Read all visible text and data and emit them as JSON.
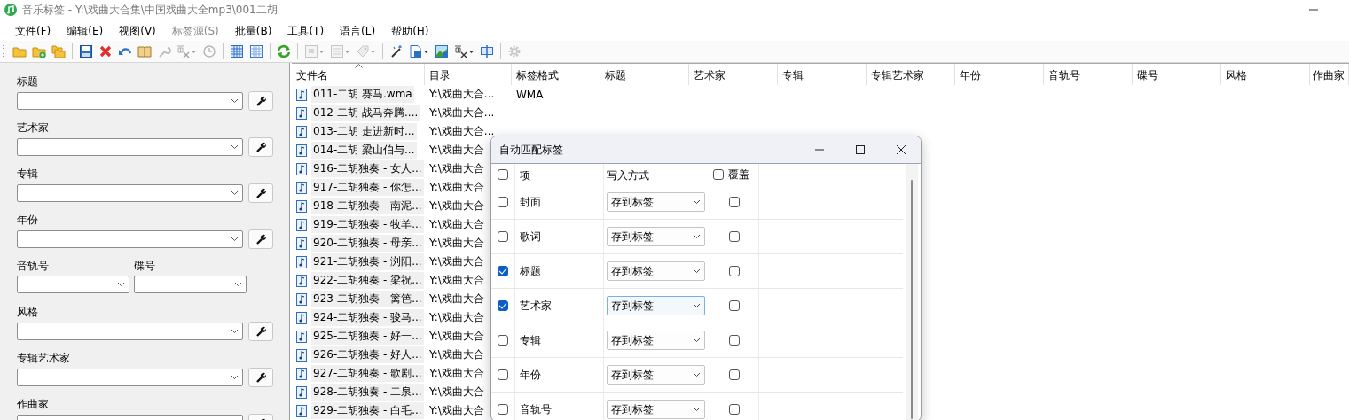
{
  "window": {
    "title": "音乐标签 - Y:\\戏曲大合集\\中国戏曲大全mp3\\001二胡"
  },
  "menu": [
    {
      "label": "文件(F)",
      "disabled": false
    },
    {
      "label": "编辑(E)",
      "disabled": false
    },
    {
      "label": "视图(V)",
      "disabled": false
    },
    {
      "label": "标签源(S)",
      "disabled": true
    },
    {
      "label": "批量(B)",
      "disabled": false
    },
    {
      "label": "工具(T)",
      "disabled": false
    },
    {
      "label": "语言(L)",
      "disabled": false
    },
    {
      "label": "帮助(H)",
      "disabled": false
    }
  ],
  "toolbar": [
    {
      "kind": "folder",
      "disabled": false,
      "dropdown": false
    },
    {
      "kind": "folder-add",
      "disabled": false,
      "dropdown": false
    },
    {
      "kind": "folders",
      "disabled": false,
      "dropdown": false
    },
    {
      "kind": "sep"
    },
    {
      "kind": "save",
      "disabled": false,
      "dropdown": false
    },
    {
      "kind": "delete",
      "disabled": false,
      "dropdown": false
    },
    {
      "kind": "undo",
      "disabled": false,
      "dropdown": false
    },
    {
      "kind": "book",
      "disabled": false,
      "dropdown": false
    },
    {
      "kind": "wrench",
      "disabled": true,
      "dropdown": false
    },
    {
      "kind": "convert",
      "disabled": true,
      "dropdown": true
    },
    {
      "kind": "clock",
      "disabled": true,
      "dropdown": false
    },
    {
      "kind": "sep"
    },
    {
      "kind": "grid",
      "disabled": false,
      "dropdown": false
    },
    {
      "kind": "grid-small",
      "disabled": false,
      "dropdown": false
    },
    {
      "kind": "sep"
    },
    {
      "kind": "refresh",
      "disabled": false,
      "dropdown": false
    },
    {
      "kind": "sep"
    },
    {
      "kind": "picture",
      "disabled": true,
      "dropdown": true
    },
    {
      "kind": "text",
      "disabled": true,
      "dropdown": true
    },
    {
      "kind": "tag",
      "disabled": true,
      "dropdown": true
    },
    {
      "kind": "sep"
    },
    {
      "kind": "wand",
      "disabled": false,
      "dropdown": false
    },
    {
      "kind": "doc-save",
      "disabled": false,
      "dropdown": true
    },
    {
      "kind": "picture-save",
      "disabled": false,
      "dropdown": false
    },
    {
      "kind": "convert",
      "disabled": false,
      "dropdown": true
    },
    {
      "kind": "window",
      "disabled": false,
      "dropdown": false
    },
    {
      "kind": "sep"
    },
    {
      "kind": "gear",
      "disabled": true,
      "dropdown": false
    }
  ],
  "tag_panel": {
    "fields": [
      {
        "kind": "single",
        "label": "标题"
      },
      {
        "kind": "single",
        "label": "艺术家"
      },
      {
        "kind": "single",
        "label": "专辑"
      },
      {
        "kind": "single",
        "label": "年份"
      },
      {
        "kind": "pair",
        "label": "音轨号",
        "label_2": "碟号"
      },
      {
        "kind": "single",
        "label": "风格"
      },
      {
        "kind": "single",
        "label": "专辑艺术家"
      },
      {
        "kind": "single",
        "label": "作曲家"
      }
    ]
  },
  "table": {
    "columns": [
      {
        "label": "文件名",
        "sorted_ascending": true
      },
      {
        "label": "目录",
        "sorted_ascending": false
      },
      {
        "label": "标签格式",
        "sorted_ascending": false
      },
      {
        "label": "标题",
        "sorted_ascending": false
      },
      {
        "label": "艺术家",
        "sorted_ascending": false
      },
      {
        "label": "专辑",
        "sorted_ascending": false
      },
      {
        "label": "专辑艺术家",
        "sorted_ascending": false
      },
      {
        "label": "年份",
        "sorted_ascending": false
      },
      {
        "label": "音轨号",
        "sorted_ascending": false
      },
      {
        "label": "碟号",
        "sorted_ascending": false
      },
      {
        "label": "风格",
        "sorted_ascending": false
      },
      {
        "label": "作曲家",
        "sorted_ascending": false
      }
    ],
    "rows": [
      {
        "file": "011-二胡 赛马.wma",
        "dir": "Y:\\戏曲大合...",
        "format": "WMA"
      },
      {
        "file": "012-二胡 战马奔腾....",
        "dir": "Y:\\戏曲大合..."
      },
      {
        "file": "013-二胡 走进新时...",
        "dir": "Y:\\戏曲大合..."
      },
      {
        "file": "014-二胡 梁山伯与...",
        "dir": "Y:\\戏曲大合"
      },
      {
        "file": "916-二胡独奏 - 女人...",
        "dir": "Y:\\戏曲大合"
      },
      {
        "file": "917-二胡独奏 - 你怎...",
        "dir": "Y:\\戏曲大合"
      },
      {
        "file": "918-二胡独奏 - 南泥...",
        "dir": "Y:\\戏曲大合"
      },
      {
        "file": "919-二胡独奏 - 牧羊...",
        "dir": "Y:\\戏曲大合"
      },
      {
        "file": "920-二胡独奏 - 母亲...",
        "dir": "Y:\\戏曲大合"
      },
      {
        "file": "921-二胡独奏 - 浏阳...",
        "dir": "Y:\\戏曲大合"
      },
      {
        "file": "922-二胡独奏 - 梁祝...",
        "dir": "Y:\\戏曲大合"
      },
      {
        "file": "923-二胡独奏 - 篱笆...",
        "dir": "Y:\\戏曲大合"
      },
      {
        "file": "924-二胡独奏 - 骏马...",
        "dir": "Y:\\戏曲大合"
      },
      {
        "file": "925-二胡独奏 - 好一...",
        "dir": "Y:\\戏曲大合"
      },
      {
        "file": "926-二胡独奏 - 好人...",
        "dir": "Y:\\戏曲大合"
      },
      {
        "file": "927-二胡独奏 - 歌剧...",
        "dir": "Y:\\戏曲大合"
      },
      {
        "file": "928-二胡独奏 - 二泉...",
        "dir": "Y:\\戏曲大合"
      },
      {
        "file": "929-二胡独奏 - 白毛...",
        "dir": "Y:\\戏曲大合"
      }
    ]
  },
  "dialog": {
    "title": "自动匹配标签",
    "header": {
      "checked": false,
      "item": "项",
      "mode": "写入方式",
      "overwrite_checked": false,
      "overwrite": "覆盖"
    },
    "rows": [
      {
        "checked": false,
        "item": "封面",
        "mode": "存到标签",
        "focused": false,
        "overwrite": false
      },
      {
        "checked": false,
        "item": "歌词",
        "mode": "存到标签",
        "focused": false,
        "overwrite": false
      },
      {
        "checked": true,
        "item": "标题",
        "mode": "存到标签",
        "focused": false,
        "overwrite": false
      },
      {
        "checked": true,
        "item": "艺术家",
        "mode": "存到标签",
        "focused": true,
        "overwrite": false
      },
      {
        "checked": false,
        "item": "专辑",
        "mode": "存到标签",
        "focused": false,
        "overwrite": false
      },
      {
        "checked": false,
        "item": "年份",
        "mode": "存到标签",
        "focused": false,
        "overwrite": false
      },
      {
        "checked": false,
        "item": "音轨号",
        "mode": "存到标签",
        "focused": false,
        "overwrite": false
      }
    ]
  }
}
